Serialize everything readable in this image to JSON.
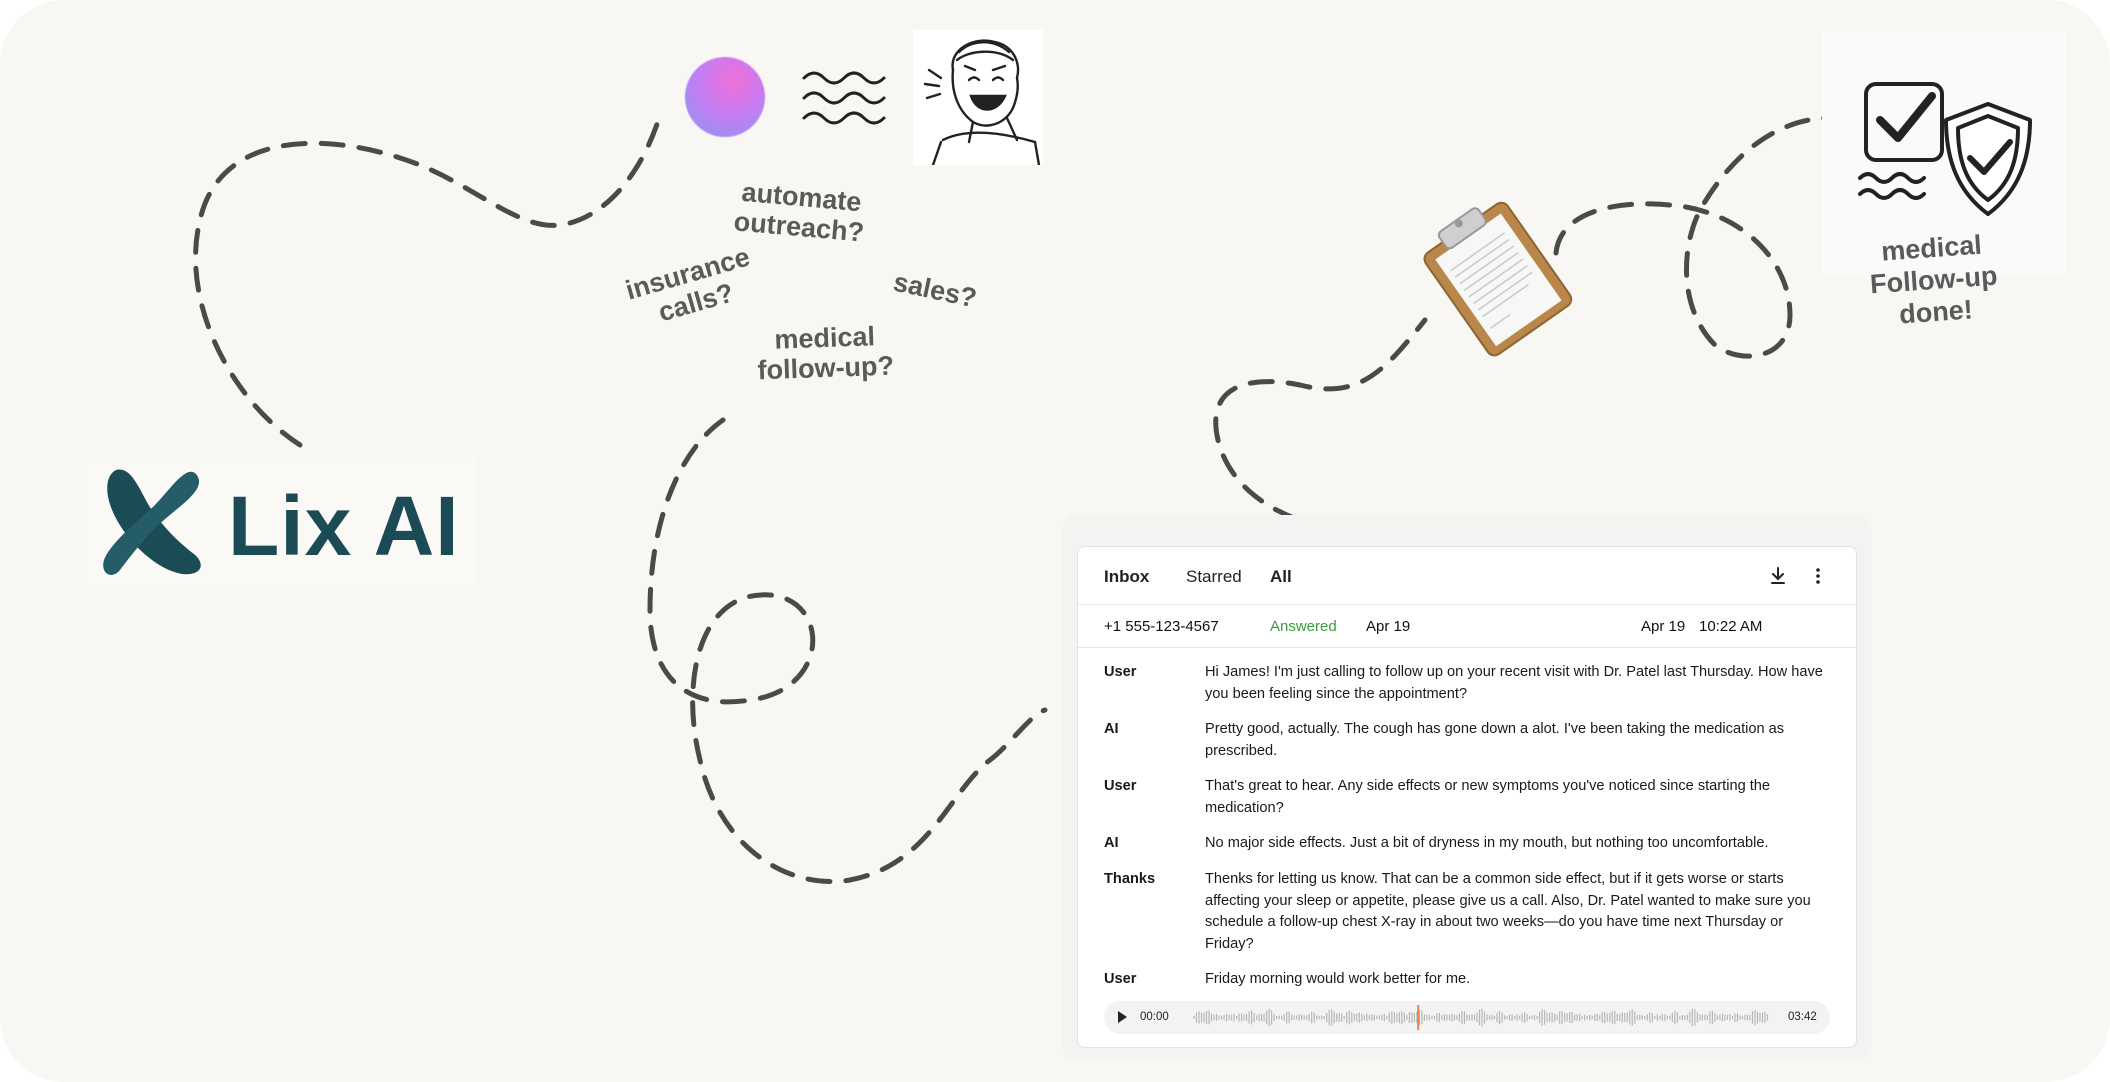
{
  "brand": {
    "name": "Lix AI"
  },
  "questions": {
    "automate": "automate\noutreach?",
    "insurance": "insurance\ncalls?",
    "sales": "sales?",
    "medical": "medical\nfollow-up?"
  },
  "done_label": "medical\nFollow-up\ndone!",
  "inbox": {
    "tabs": [
      "Inbox",
      "Starred",
      "All"
    ],
    "call": {
      "phone": "+1 555-123-4567",
      "status": "Answered",
      "date": "Apr 19",
      "date2": "Apr 19",
      "time": "10:22 AM",
      "status_color": "#3a9b3a"
    },
    "transcript": [
      {
        "speaker": "User",
        "text": "Hi James! I'm just calling to follow up on your recent visit with Dr. Patel last Thursday. How have you been feeling since the appointment?"
      },
      {
        "speaker": "AI",
        "text": "Pretty good, actually. The cough has gone down a alot. I've been taking the medication as prescribed."
      },
      {
        "speaker": "User",
        "text": "That's great to hear. Any side effects or new symptoms you've noticed since starting the medication?"
      },
      {
        "speaker": "AI",
        "text": "No major side effects. Just a bit of dryness in my mouth, but nothing too uncomfortable."
      },
      {
        "speaker": "Thanks",
        "text": "Thenks for letting us know. That can be a common side effect, but if it gets worse or starts affecting your sleep or appetite, please give us a call. Also, Dr. Patel wanted to make sure you schedule a follow-up chest X-ray in about two weeks—do you have time next Thursday or Friday?"
      },
      {
        "speaker": "User",
        "text": "Friday morning would work better for me."
      }
    ],
    "player": {
      "current": "00:00",
      "duration": "03:42",
      "progress": 0.39
    }
  },
  "icons": [
    "x-logo-icon",
    "wave-icon",
    "laughing-man-illustration",
    "clipboard-icon",
    "checkbox-icon",
    "shield-check-icon",
    "download-icon",
    "more-vert-icon",
    "play-icon"
  ],
  "colors": {
    "brand": "#1b4b55",
    "accent_line": "#e8834a",
    "path": "#4a4a4a"
  }
}
